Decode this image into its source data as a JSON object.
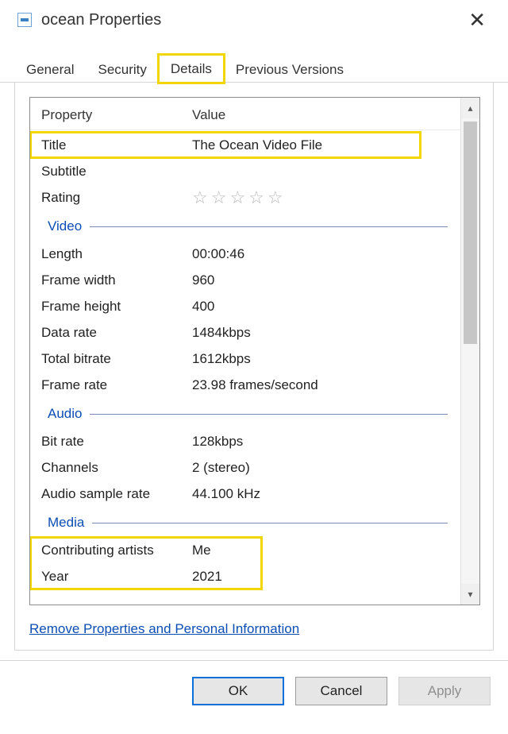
{
  "window": {
    "title": "ocean Properties"
  },
  "tabs": [
    "General",
    "Security",
    "Details",
    "Previous Versions"
  ],
  "active_tab_index": 2,
  "columns": {
    "property": "Property",
    "value": "Value"
  },
  "description": {
    "title_label": "Title",
    "title_value": "The Ocean Video File",
    "subtitle_label": "Subtitle",
    "subtitle_value": "",
    "rating_label": "Rating"
  },
  "video": {
    "section": "Video",
    "length_label": "Length",
    "length_value": "00:00:46",
    "frame_width_label": "Frame width",
    "frame_width_value": "960",
    "frame_height_label": "Frame height",
    "frame_height_value": "400",
    "data_rate_label": "Data rate",
    "data_rate_value": "1484kbps",
    "total_bitrate_label": "Total bitrate",
    "total_bitrate_value": "1612kbps",
    "frame_rate_label": "Frame rate",
    "frame_rate_value": "23.98 frames/second"
  },
  "audio": {
    "section": "Audio",
    "bit_rate_label": "Bit rate",
    "bit_rate_value": "128kbps",
    "channels_label": "Channels",
    "channels_value": "2 (stereo)",
    "sample_rate_label": "Audio sample rate",
    "sample_rate_value": "44.100 kHz"
  },
  "media": {
    "section": "Media",
    "artists_label": "Contributing artists",
    "artists_value": "Me",
    "year_label": "Year",
    "year_value": "2021"
  },
  "link": "Remove Properties and Personal Information",
  "buttons": {
    "ok": "OK",
    "cancel": "Cancel",
    "apply": "Apply"
  }
}
